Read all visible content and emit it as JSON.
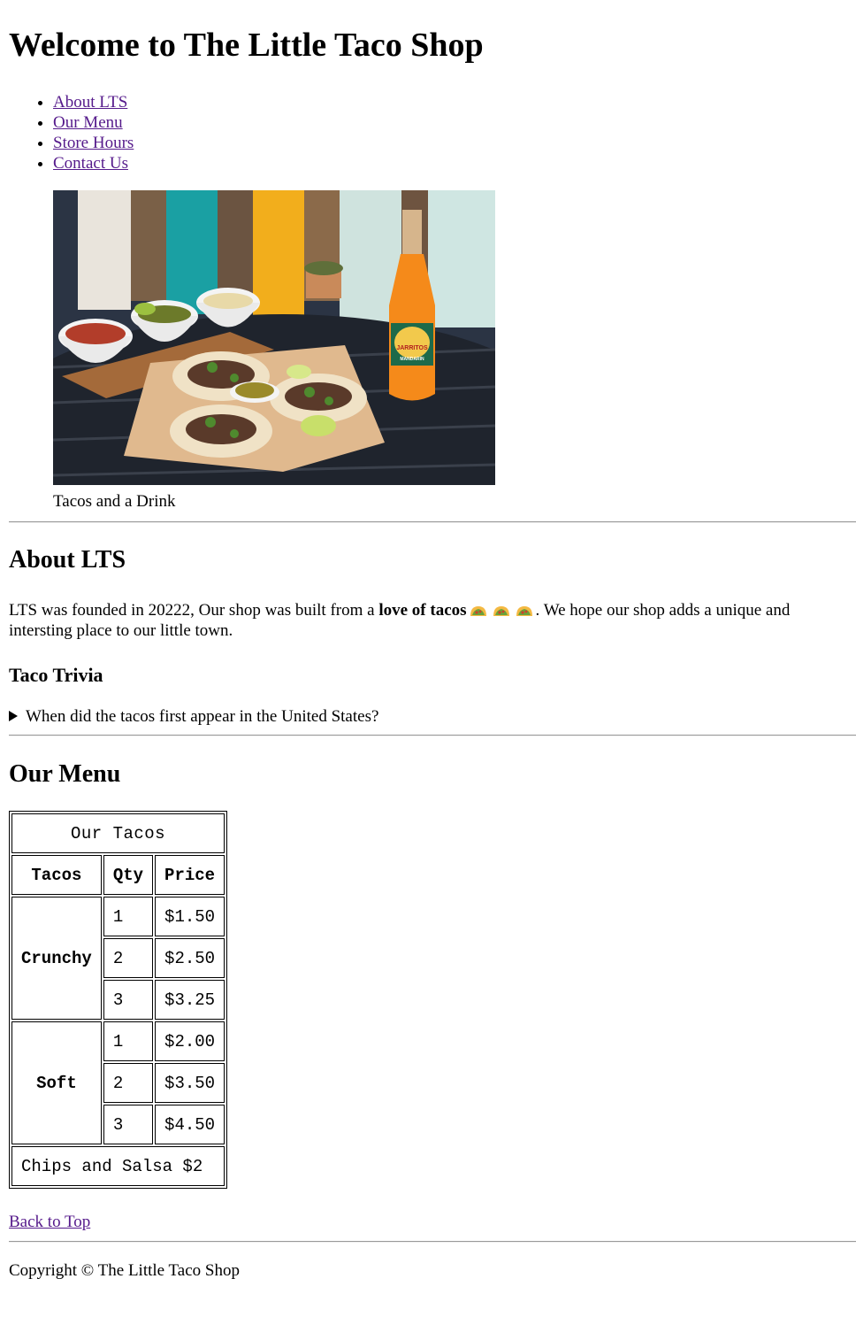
{
  "page": {
    "title": "Welcome to The Little Taco Shop"
  },
  "nav": {
    "items": [
      {
        "label": "About LTS"
      },
      {
        "label": "Our Menu"
      },
      {
        "label": "Store Hours"
      },
      {
        "label": "Contact Us"
      }
    ]
  },
  "figure": {
    "caption": "Tacos and a Drink",
    "bottle_label": "JARRITOS",
    "bottle_flavor": "MANDARIN"
  },
  "about": {
    "heading": "About LTS",
    "text_before": "LTS was founded in 20222, Our shop was built from a ",
    "text_bold": "love of tacos",
    "text_after": ". We hope our shop adds a unique and intersting place to our little town.",
    "emoji_icons": [
      "taco-icon",
      "taco-icon",
      "taco-icon"
    ]
  },
  "trivia": {
    "heading": "Taco Trivia",
    "question": "When did the tacos first appear in the United States?"
  },
  "menu": {
    "heading": "Our Menu",
    "table_caption": "Our Tacos",
    "headers": [
      "Tacos",
      "Qty",
      "Price"
    ],
    "groups": [
      {
        "name": "Crunchy",
        "rows": [
          {
            "qty": "1",
            "price": "$1.50"
          },
          {
            "qty": "2",
            "price": "$2.50"
          },
          {
            "qty": "3",
            "price": "$3.25"
          }
        ]
      },
      {
        "name": "Soft",
        "rows": [
          {
            "qty": "1",
            "price": "$2.00"
          },
          {
            "qty": "2",
            "price": "$3.50"
          },
          {
            "qty": "3",
            "price": "$4.50"
          }
        ]
      }
    ],
    "footer": "Chips and Salsa $2"
  },
  "back_to_top": "Back to Top",
  "footer": {
    "copyright": "Copyright © The Little Taco Shop"
  },
  "colors": {
    "link_visited": "#551a8b",
    "rule": "#9a9a9a"
  }
}
